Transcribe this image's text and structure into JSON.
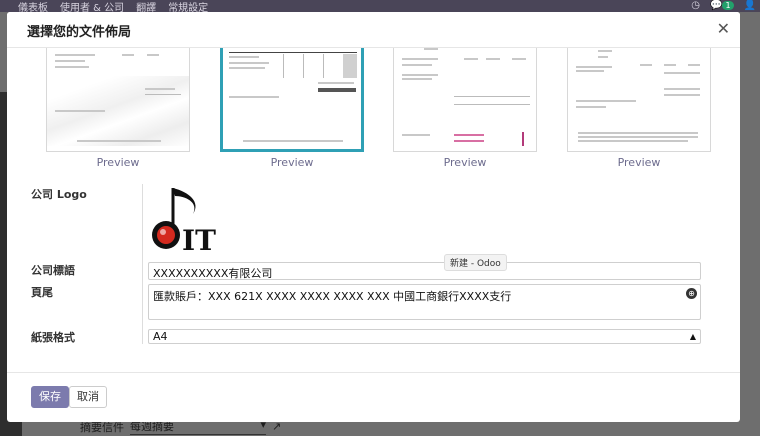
{
  "topbar": {
    "menu": [
      "儀表板",
      "使用者 & 公司",
      "翻譯",
      "常規設定"
    ],
    "notification_count": "1"
  },
  "background": {
    "footer_label": "摘要信件",
    "footer_value": "每週摘要"
  },
  "modal": {
    "title": "選擇您的文件佈局",
    "close_icon": "close-icon",
    "layouts": [
      {
        "preview": "Preview",
        "selected": false
      },
      {
        "preview": "Preview",
        "selected": true
      },
      {
        "preview": "Preview",
        "selected": false
      },
      {
        "preview": "Preview",
        "selected": false
      }
    ],
    "logo_label": "公司 Logo",
    "logo_text": "IT",
    "tagline_label": "公司標語",
    "tagline_value": "XXXXXXXXXX有限公司",
    "footer_label": "頁尾",
    "footer_value": "匯款賬戶：XXX   621X XXXX XXXX XXXX XXX 中國工商銀行XXXX支行",
    "paper_label": "紙張格式",
    "paper_value": "A4",
    "tooltip": "新建 - Odoo",
    "save_label": "保存",
    "cancel_label": "取消"
  },
  "colors": {
    "accent": "#7c7bad",
    "selected_border": "#2fa0b5",
    "logo_red": "#d42a1f"
  }
}
